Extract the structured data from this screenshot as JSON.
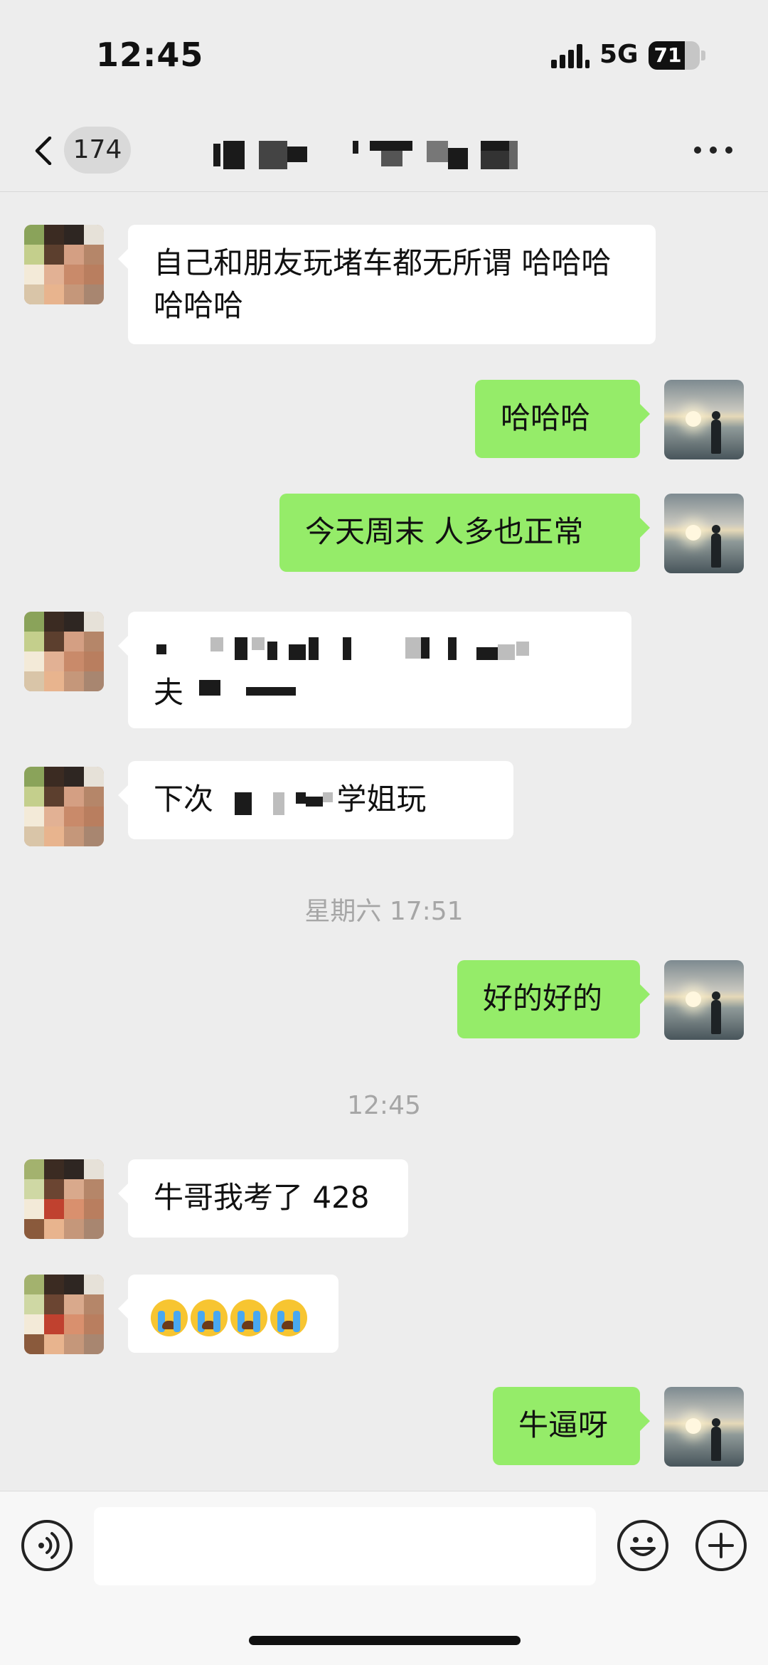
{
  "status_bar": {
    "time": "12:45",
    "network": "5G",
    "battery_level": "71",
    "battery_fraction": 0.71,
    "icons": [
      "signal-icon",
      "battery-icon"
    ]
  },
  "nav": {
    "back_icon": "chevron-left-icon",
    "unread_count": "174",
    "title": "",
    "more_icon": "ellipsis-icon"
  },
  "messages": [
    {
      "side": "in",
      "text": "自己和朋友玩堵车都无所谓 哈哈哈哈哈哈"
    },
    {
      "side": "out",
      "text": "哈哈哈"
    },
    {
      "side": "out",
      "text": "今天周末 人多也正常"
    },
    {
      "side": "in",
      "text": "夫"
    },
    {
      "side": "in",
      "text": "下次 学姐玩"
    },
    {
      "timestamp": "星期六 17:51"
    },
    {
      "side": "out",
      "text": "好的好的"
    },
    {
      "timestamp": "12:45"
    },
    {
      "side": "in",
      "text": "牛哥我考了 428"
    },
    {
      "side": "in",
      "emoji": [
        "loudly-crying-face",
        "loudly-crying-face",
        "loudly-crying-face",
        "loudly-crying-face"
      ]
    },
    {
      "side": "out",
      "text": "牛逼呀"
    }
  ],
  "input_bar": {
    "voice_icon": "voice-icon",
    "emoji_icon": "smiley-icon",
    "plus_icon": "plus-circle-icon",
    "value": "",
    "placeholder": ""
  }
}
